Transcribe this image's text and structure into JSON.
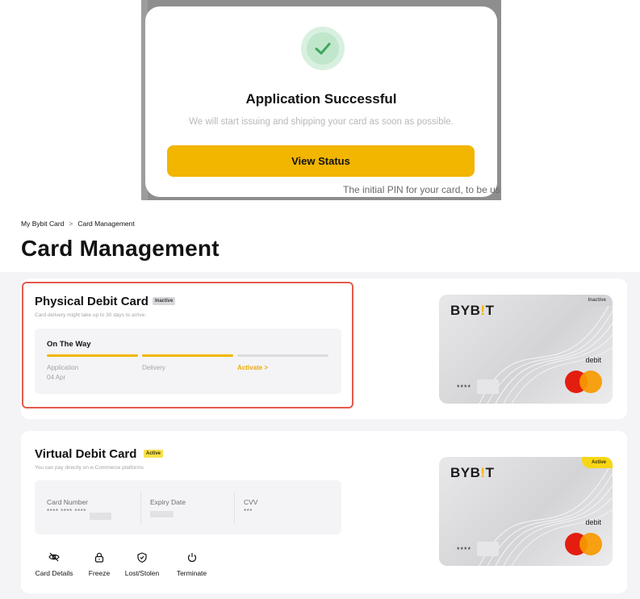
{
  "modal": {
    "title": "Application Successful",
    "subtitle": "We will start issuing and shipping your card as soon as possible.",
    "button_label": "View Status",
    "background_text": "The initial PIN for your card, to be us"
  },
  "breadcrumb": {
    "parent": "My Bybit Card",
    "separator": ">",
    "current": "Card Management"
  },
  "page_title": "Card Management",
  "physical_card": {
    "title": "Physical Debit Card",
    "status": "Inactive",
    "subtitle": "Card delivery might take up to 30 days to arrive.",
    "stage": "On The Way",
    "steps": [
      {
        "label": "Application",
        "date": "04 Apr",
        "done": true
      },
      {
        "label": "Delivery",
        "done": true
      },
      {
        "label": "Activate >",
        "done": false
      }
    ],
    "card_image": {
      "brand": "BYB",
      "brand_accent": "!",
      "brand_end": "T",
      "tag": "Inactive",
      "type": "debit",
      "number_prefix": "****"
    }
  },
  "virtual_card": {
    "title": "Virtual Debit Card",
    "status": "Active",
    "subtitle": "You can pay directly on e-Commerce platforms",
    "details": {
      "card_number_label": "Card Number",
      "card_number_value": "**** **** ****",
      "expiry_label": "Expiry Date",
      "cvv_label": "CVV",
      "cvv_value": "***"
    },
    "actions": [
      {
        "label": "Card Details",
        "icon": "eye-off-icon"
      },
      {
        "label": "Freeze",
        "icon": "lock-icon"
      },
      {
        "label": "Lost/Stolen",
        "icon": "shield-icon"
      },
      {
        "label": "Terminate",
        "icon": "power-icon"
      }
    ],
    "card_image": {
      "brand": "BYB",
      "brand_accent": "!",
      "brand_end": "T",
      "tag": "Active",
      "type": "debit",
      "number_prefix": "****"
    }
  },
  "colors": {
    "accent": "#f2b500",
    "success": "#3ea85c",
    "highlight_border": "#e35a4f"
  }
}
